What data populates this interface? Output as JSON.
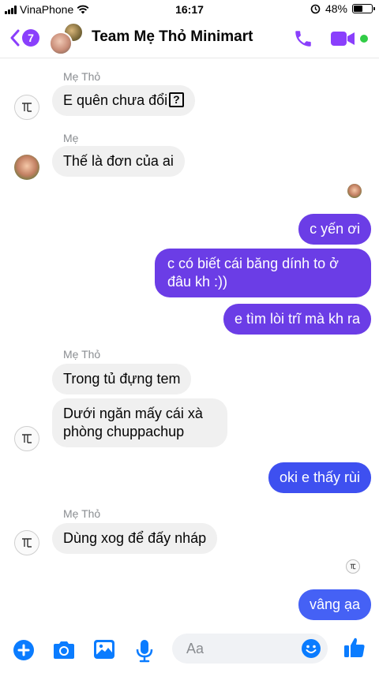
{
  "status_bar": {
    "carrier": "VinaPhone",
    "time": "16:17",
    "battery_percent": "48%",
    "battery_level": 0.48
  },
  "header": {
    "back_count": "7",
    "title": "Team Mẹ Thỏ Minimart",
    "accent_color": "#8a3ffc",
    "online_color": "#31cc46"
  },
  "messages": {
    "m1_sender": "Mẹ Thỏ",
    "m1_text": "E quên chưa đổi",
    "m2_sender": "Mẹ",
    "m2_text": "Thế là đơn của ai",
    "m3_text": "c yến ơi",
    "m4_text": "c có biết cái băng dính to ở đâu kh :))",
    "m5_text": "e tìm lòi trĩ mà kh ra",
    "m6_sender": "Mẹ Thỏ",
    "m6_text": "Trong tủ đựng tem",
    "m7_text": "Dưới ngăn mấy cái xà phòng chuppachup",
    "m8_text": "oki e thấy rùi",
    "m9_sender": "Mẹ Thỏ",
    "m9_text": "Dùng xog để đấy nháp",
    "m10_text": "vâng ạa"
  },
  "composer": {
    "placeholder": "Aa"
  },
  "icons": [
    "wifi-icon",
    "alarm-icon",
    "back-chevron-icon",
    "phone-icon",
    "video-icon",
    "plus-icon",
    "camera-icon",
    "photo-icon",
    "microphone-icon",
    "emoji-icon",
    "thumbs-up-icon"
  ]
}
